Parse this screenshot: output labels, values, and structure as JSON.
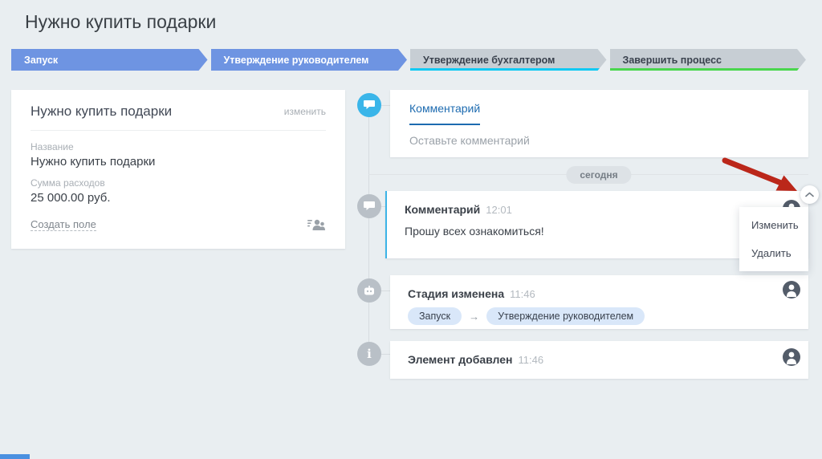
{
  "page": {
    "title": "Нужно купить подарки"
  },
  "stages": [
    {
      "label": "Запуск",
      "state": "passed"
    },
    {
      "label": "Утверждение руководителем",
      "state": "current"
    },
    {
      "label": "Утверждение бухгалтером",
      "state": "upcoming"
    },
    {
      "label": "Завершить процесс",
      "state": "final"
    }
  ],
  "details_card": {
    "title": "Нужно купить подарки",
    "edit_label": "изменить",
    "fields": [
      {
        "label": "Название",
        "value": "Нужно купить подарки"
      },
      {
        "label": "Сумма расходов",
        "value": "25 000.00 руб."
      }
    ],
    "create_field_label": "Создать поле"
  },
  "timeline": {
    "composer": {
      "tab": "Комментарий",
      "placeholder": "Оставьте комментарий"
    },
    "date_badge": "сегодня",
    "entries": [
      {
        "type": "comment",
        "title": "Комментарий",
        "time": "12:01",
        "text": "Прошу всех ознакомиться!"
      },
      {
        "type": "stage-change",
        "title": "Стадия изменена",
        "time": "11:46",
        "from": "Запуск",
        "arrow": "→",
        "to": "Утверждение руководителем"
      },
      {
        "type": "info",
        "title": "Элемент добавлен",
        "time": "11:46"
      }
    ]
  },
  "context_menu": {
    "items": [
      "Изменить",
      "Удалить"
    ]
  },
  "icons": {
    "info_glyph": "i",
    "names": [
      "comment-bubble-icon",
      "robot-icon",
      "info-icon",
      "participants-icon",
      "chevron-up-icon",
      "person-avatar-icon"
    ]
  },
  "colors": {
    "background": "#e9eef1",
    "stage_blue": "#6e94e2",
    "stage_gray": "#c7ced4",
    "stage_cyan_edge": "#10c9f3",
    "stage_green_edge": "#49d64d",
    "tab_blue": "#1d6bb0",
    "comment_border": "#3cb4e7",
    "timeline_icon_blue": "#3ab5e9",
    "timeline_icon_gray": "#b9c0c7",
    "avatar_bg": "#535c69",
    "annotation_arrow_red": "#bb271a",
    "bottom_bar_blue": "#4a90e0"
  }
}
